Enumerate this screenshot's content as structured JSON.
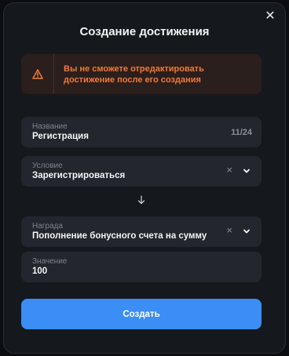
{
  "modal": {
    "title": "Создание достижения",
    "close_icon": "close-icon"
  },
  "alert": {
    "icon": "warning-icon",
    "text_line1": "Вы не сможете отредактировать",
    "text_line2": "достижение после его создания",
    "color": "#f07a3a"
  },
  "name_field": {
    "label": "Название",
    "value": "Регистрация",
    "counter": "11/24"
  },
  "condition_field": {
    "label": "Условие",
    "value": "Зарегистрироваться",
    "clear_icon": "clear-icon",
    "dropdown_icon": "chevron-down-icon"
  },
  "flow_icon": "arrow-down-icon",
  "reward_field": {
    "label": "Награда",
    "value": "Пополнение бонусного счета на сумму",
    "clear_icon": "clear-icon",
    "dropdown_icon": "chevron-down-icon"
  },
  "amount_field": {
    "label": "Значение",
    "value": "100"
  },
  "submit": {
    "label": "Создать",
    "color": "#3a8ef6"
  }
}
